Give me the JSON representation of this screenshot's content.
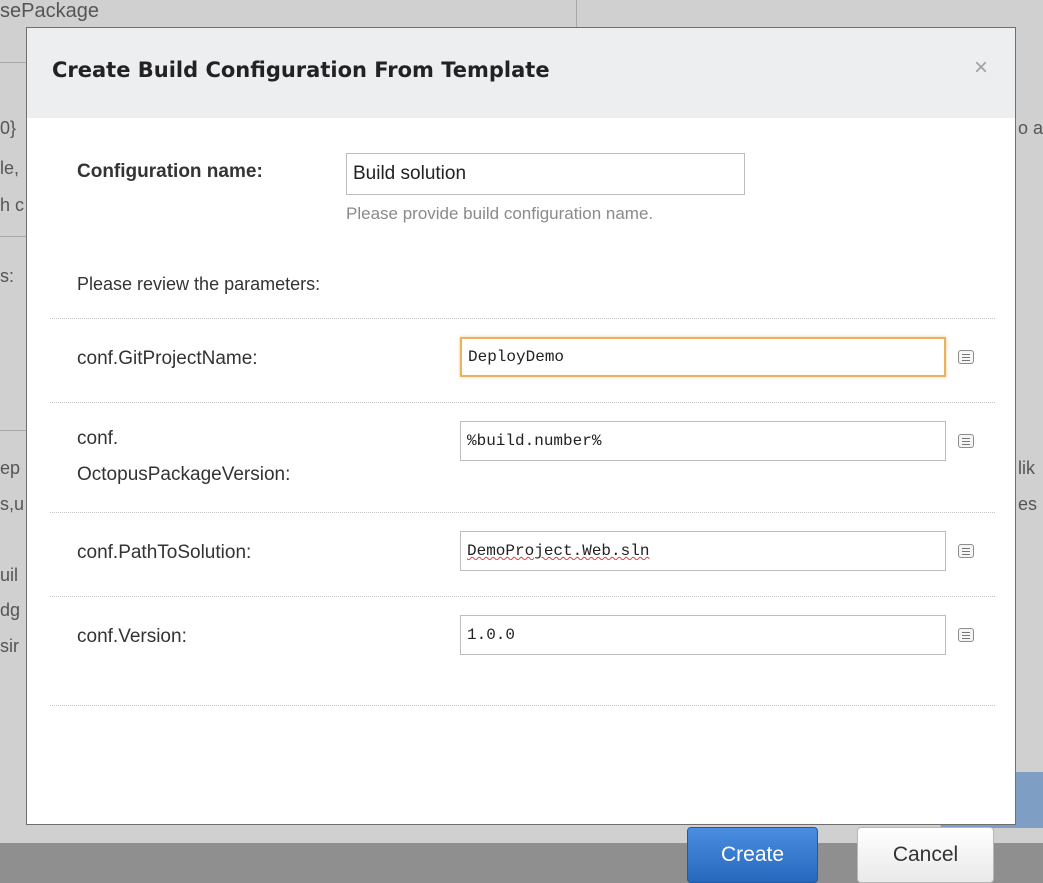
{
  "background": {
    "fragments": [
      "sePackage",
      "0}",
      "le,",
      "h c",
      "s:",
      "ep",
      "s,u",
      "uil",
      "dg",
      "sir",
      "lik",
      "es",
      "o a"
    ]
  },
  "dialog": {
    "title": "Create Build Configuration From Template",
    "close_glyph": "×",
    "config_name_label": "Configuration name:",
    "config_name_value": "Build solution",
    "config_name_hint": "Please provide build configuration name.",
    "review_text": "Please review the parameters:",
    "parameters": [
      {
        "label": "conf.GitProjectName:",
        "value": "DeployDemo"
      },
      {
        "label": "conf.\nOctopusPackageVersion:",
        "value": "%build.number%"
      },
      {
        "label": "conf.PathToSolution:",
        "value": "DemoProject.Web.sln"
      },
      {
        "label": "conf.Version:",
        "value": "1.0.0"
      }
    ],
    "create_label": "Create",
    "cancel_label": "Cancel"
  },
  "colors": {
    "primary_button": "#2f73c9",
    "focus_border": "#e8b25e",
    "header_background": "#edeef0"
  }
}
